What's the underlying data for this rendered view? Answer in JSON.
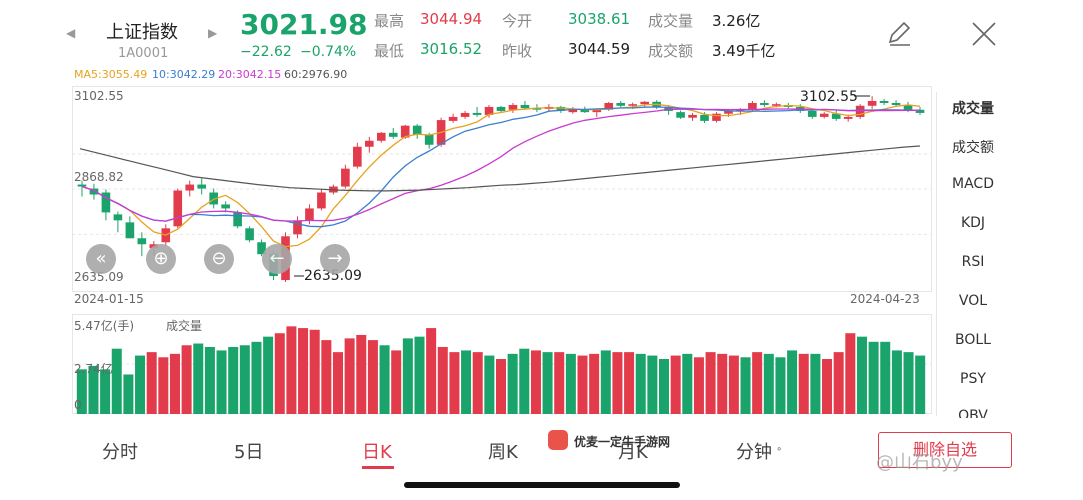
{
  "header": {
    "prev_arrow": "◀",
    "next_arrow": "▶",
    "name": "上证指数",
    "code": "1A0001",
    "price": "3021.98",
    "change": "−22.62",
    "change_pct": "−0.74%",
    "stats": [
      {
        "label": "最高",
        "value": "3044.94",
        "color": "red"
      },
      {
        "label": "今开",
        "value": "3038.61",
        "color": "green"
      },
      {
        "label": "成交量",
        "value": "3.26亿",
        "color": "dark"
      },
      {
        "label": "最低",
        "value": "3016.52",
        "color": "green"
      },
      {
        "label": "昨收",
        "value": "3044.59",
        "color": "dark"
      },
      {
        "label": "成交额",
        "value": "3.49千亿",
        "color": "dark"
      }
    ],
    "edit_icon": "pencil-icon",
    "close_icon": "close-icon"
  },
  "ma_legend": {
    "ma5": "MA5:3055.49",
    "ma10": "10:3042.29",
    "ma20": "20:3042.15",
    "ma60": "60:2976.90",
    "ma5_color": "#e6a320",
    "ma10_color": "#3b7ed0",
    "ma20_color": "#c93bd0",
    "ma60_color": "#555555"
  },
  "kline": {
    "y_top": "3102.55",
    "y_mid": "2868.82",
    "y_bottom": "2635.09",
    "date_start": "2024-01-15",
    "date_end": "2024-04-23",
    "max_label": "3102.55",
    "min_label": "2635.09"
  },
  "volume": {
    "y_top": "5.47亿(手)",
    "title": "成交量",
    "y_mid": "2.74亿",
    "y_zero": "0"
  },
  "sidebar": [
    "成交量",
    "成交额",
    "MACD",
    "KDJ",
    "RSI",
    "VOL",
    "BOLL",
    "PSY",
    "OBV"
  ],
  "tabs": [
    "分时",
    "5日",
    "日K",
    "周K",
    "月K",
    "分钟"
  ],
  "tab_suffix": "∘",
  "delete_button": "删除自选",
  "watermark": {
    "brand": "优麦一定牛手游网",
    "user": "@山石byy"
  },
  "colors": {
    "up": "#e23b4b",
    "down": "#1aa36a"
  },
  "chart_data": {
    "type": "candlestick",
    "candles": [
      [
        2880,
        2890,
        2850,
        2875
      ],
      [
        2870,
        2882,
        2842,
        2855
      ],
      [
        2860,
        2868,
        2790,
        2810
      ],
      [
        2805,
        2812,
        2760,
        2790
      ],
      [
        2785,
        2800,
        2745,
        2745
      ],
      [
        2745,
        2760,
        2700,
        2730
      ],
      [
        2720,
        2738,
        2700,
        2730
      ],
      [
        2735,
        2780,
        2725,
        2770
      ],
      [
        2775,
        2870,
        2770,
        2865
      ],
      [
        2865,
        2890,
        2850,
        2880
      ],
      [
        2880,
        2895,
        2855,
        2870
      ],
      [
        2860,
        2870,
        2820,
        2830
      ],
      [
        2830,
        2838,
        2810,
        2820
      ],
      [
        2810,
        2815,
        2770,
        2775
      ],
      [
        2770,
        2775,
        2735,
        2740
      ],
      [
        2735,
        2742,
        2700,
        2705
      ],
      [
        2705,
        2712,
        2640,
        2650
      ],
      [
        2640,
        2760,
        2635,
        2750
      ],
      [
        2755,
        2800,
        2745,
        2790
      ],
      [
        2790,
        2830,
        2780,
        2820
      ],
      [
        2820,
        2870,
        2815,
        2860
      ],
      [
        2860,
        2880,
        2855,
        2875
      ],
      [
        2875,
        2930,
        2870,
        2920
      ],
      [
        2925,
        2985,
        2920,
        2975
      ],
      [
        2975,
        3000,
        2960,
        2990
      ],
      [
        2990,
        3012,
        2985,
        3010
      ],
      [
        3010,
        3022,
        2995,
        3000
      ],
      [
        2998,
        3030,
        2995,
        3028
      ],
      [
        3028,
        3032,
        2995,
        3005
      ],
      [
        3005,
        3010,
        2970,
        2980
      ],
      [
        2980,
        3048,
        2975,
        3042
      ],
      [
        3040,
        3058,
        3035,
        3050
      ],
      [
        3050,
        3065,
        3045,
        3060
      ],
      [
        3060,
        3075,
        3050,
        3055
      ],
      [
        3055,
        3080,
        3048,
        3075
      ],
      [
        3075,
        3078,
        3060,
        3065
      ],
      [
        3068,
        3085,
        3060,
        3080
      ],
      [
        3080,
        3090,
        3070,
        3072
      ],
      [
        3072,
        3082,
        3062,
        3070
      ],
      [
        3070,
        3082,
        3065,
        3075
      ],
      [
        3075,
        3078,
        3060,
        3065
      ],
      [
        3062,
        3075,
        3058,
        3070
      ],
      [
        3070,
        3076,
        3060,
        3062
      ],
      [
        3062,
        3070,
        3050,
        3068
      ],
      [
        3068,
        3088,
        3065,
        3085
      ],
      [
        3085,
        3090,
        3075,
        3078
      ],
      [
        3078,
        3086,
        3070,
        3082
      ],
      [
        3082,
        3090,
        3076,
        3088
      ],
      [
        3088,
        3092,
        3070,
        3075
      ],
      [
        3075,
        3080,
        3055,
        3065
      ],
      [
        3062,
        3066,
        3045,
        3048
      ],
      [
        3048,
        3060,
        3040,
        3055
      ],
      [
        3055,
        3062,
        3035,
        3040
      ],
      [
        3040,
        3062,
        3036,
        3058
      ],
      [
        3058,
        3070,
        3050,
        3065
      ],
      [
        3065,
        3072,
        3055,
        3070
      ],
      [
        3070,
        3090,
        3065,
        3085
      ],
      [
        3085,
        3092,
        3075,
        3080
      ],
      [
        3078,
        3086,
        3074,
        3082
      ],
      [
        3080,
        3085,
        3070,
        3075
      ],
      [
        3075,
        3082,
        3060,
        3065
      ],
      [
        3065,
        3070,
        3045,
        3050
      ],
      [
        3050,
        3062,
        3046,
        3058
      ],
      [
        3058,
        3066,
        3040,
        3045
      ],
      [
        3045,
        3056,
        3038,
        3050
      ],
      [
        3050,
        3082,
        3045,
        3078
      ],
      [
        3078,
        3102,
        3070,
        3090
      ],
      [
        3090,
        3095,
        3080,
        3085
      ],
      [
        3085,
        3092,
        3075,
        3080
      ],
      [
        3080,
        3088,
        3062,
        3068
      ],
      [
        3068,
        3075,
        3055,
        3060
      ]
    ],
    "volumes": [
      2.6,
      2.8,
      2.6,
      3.8,
      2.3,
      3.4,
      3.6,
      3.3,
      3.5,
      4.0,
      4.1,
      3.9,
      3.7,
      3.9,
      4.0,
      4.2,
      4.5,
      4.7,
      5.1,
      5.0,
      4.9,
      4.3,
      3.6,
      4.4,
      4.6,
      4.3,
      4.0,
      3.7,
      4.4,
      4.5,
      5.0,
      3.9,
      3.6,
      3.7,
      3.6,
      3.4,
      3.2,
      3.5,
      3.8,
      3.7,
      3.6,
      3.6,
      3.5,
      3.4,
      3.5,
      3.7,
      3.6,
      3.6,
      3.5,
      3.4,
      3.2,
      3.4,
      3.5,
      3.3,
      3.6,
      3.5,
      3.4,
      3.3,
      3.6,
      3.5,
      3.3,
      3.7,
      3.5,
      3.5,
      3.2,
      3.6,
      4.7,
      4.5,
      4.2,
      4.2,
      3.7,
      3.6,
      3.4
    ],
    "ma60": [
      2970,
      2960,
      2950,
      2940,
      2930,
      2920,
      2910,
      2900,
      2895,
      2890,
      2885,
      2880,
      2876,
      2872,
      2870,
      2868,
      2866,
      2865,
      2864,
      2864,
      2865,
      2866,
      2868,
      2870,
      2872,
      2875,
      2878,
      2880,
      2883,
      2886,
      2890,
      2894,
      2898,
      2902,
      2906,
      2910,
      2914,
      2918,
      2922,
      2926,
      2930,
      2934,
      2938,
      2942,
      2946,
      2950,
      2954,
      2958,
      2962,
      2966,
      2970,
      2974,
      2977
    ],
    "ylim": [
      2635.09,
      3102.55
    ],
    "volume_ylim": [
      0,
      5.47
    ]
  }
}
